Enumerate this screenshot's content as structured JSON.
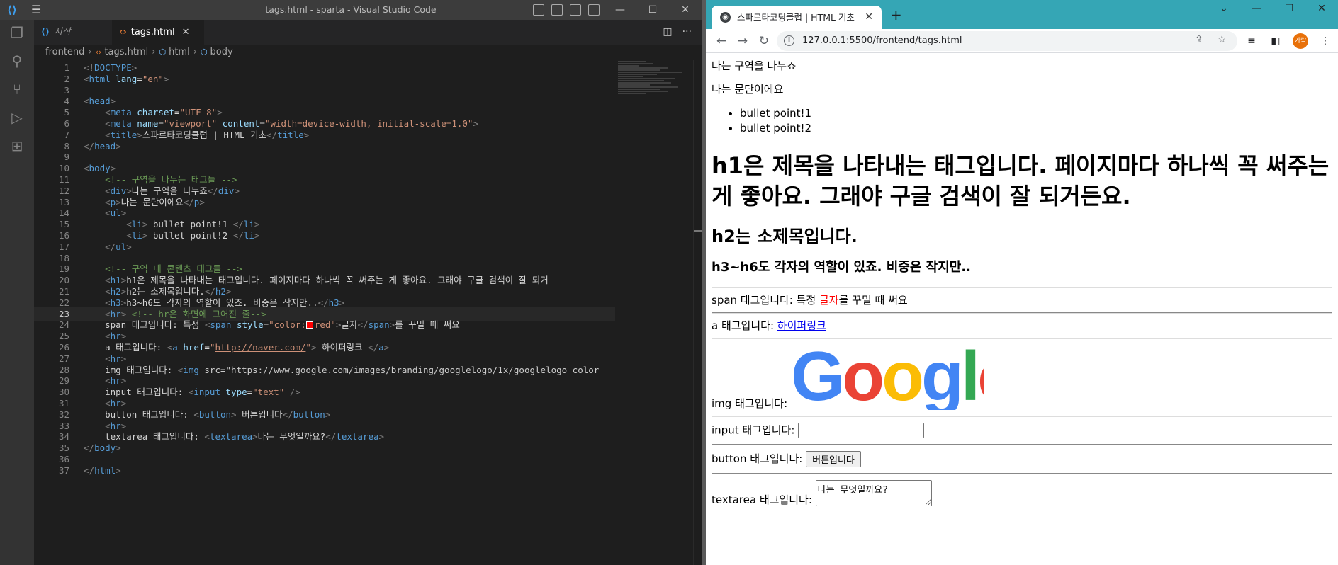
{
  "vscode": {
    "window_title": "tags.html - sparta - Visual Studio Code",
    "tabs": [
      {
        "label": "시작",
        "icon": "vscode-icon"
      },
      {
        "label": "tags.html",
        "icon": "html-file-icon"
      }
    ],
    "breadcrumb": [
      "frontend",
      "tags.html",
      "html",
      "body"
    ],
    "current_line": 23,
    "code_lines": [
      "<!DOCTYPE html>",
      "<html lang=\"en\">",
      "",
      "<head>",
      "    <meta charset=\"UTF-8\">",
      "    <meta name=\"viewport\" content=\"width=device-width, initial-scale=1.0\">",
      "    <title>스파르타코딩클럽 | HTML 기초</title>",
      "</head>",
      "",
      "<body>",
      "    <!-- 구역을 나누는 태그들 -->",
      "    <div>나는 구역을 나누죠</div>",
      "    <p>나는 문단이에요</p>",
      "    <ul>",
      "        <li> bullet point!1 </li>",
      "        <li> bullet point!2 </li>",
      "    </ul>",
      "",
      "    <!-- 구역 내 콘텐츠 태그들 -->",
      "    <h1>h1은 제목을 나타내는 태그입니다. 페이지마다 하나씩 꼭 써주는 게 좋아요. 그래야 구글 검색이 잘 되거",
      "    <h2>h2는 소제목입니다.</h2>",
      "    <h3>h3~h6도 각자의 역할이 있죠. 비중은 작지만..</h3>",
      "    <hr> <!-- hr은 화면에 그어진 줄-->",
      "    span 태그입니다: 특정 <span style=\"color:■red\">글자</span>를 꾸밀 때 써요",
      "    <hr>",
      "    a 태그입니다: <a href=\"http://naver.com/\"> 하이퍼링크 </a>",
      "    <hr>",
      "    img 태그입니다: <img src=\"https://www.google.com/images/branding/googlelogo/1x/googlelogo_color",
      "    <hr>",
      "    input 태그입니다: <input type=\"text\" />",
      "    <hr>",
      "    button 태그입니다: <button> 버튼입니다</button>",
      "    <hr>",
      "    textarea 태그입니다: <textarea>나는 무엇일까요?</textarea>",
      "</body>",
      "",
      "</html>"
    ]
  },
  "browser": {
    "tab_title": "스파르타코딩클럽 | HTML 기초",
    "url": "127.0.0.1:5500/frontend/tags.html",
    "avatar_text": "가락",
    "accent_color": "#35a6b5",
    "page": {
      "div_text": "나는 구역을 나누죠",
      "p_text": "나는 문단이에요",
      "bullets": [
        "bullet point!1",
        "bullet point!2"
      ],
      "h1": "h1은 제목을 나타내는 태그입니다. 페이지마다 하나씩 꼭 써주는 게 좋아요. 그래야 구글 검색이 잘 되거든요.",
      "h2": "h2는 소제목입니다.",
      "h3": "h3~h6도 각자의 역할이 있죠. 비중은 작지만..",
      "span_prefix": "span 태그입니다: 특정 ",
      "span_red": "글자",
      "span_suffix": "를 꾸밀 때 써요",
      "a_prefix": "a 태그입니다: ",
      "a_link": "하이퍼링크",
      "img_label": "img 태그입니다:",
      "google_logo": "Google",
      "input_label": "input 태그입니다:",
      "input_value": "",
      "button_label": "button 태그입니다:",
      "button_text": "버튼입니다",
      "textarea_label": "textarea 태그입니다:",
      "textarea_value": "나는 무엇일까요?"
    }
  }
}
